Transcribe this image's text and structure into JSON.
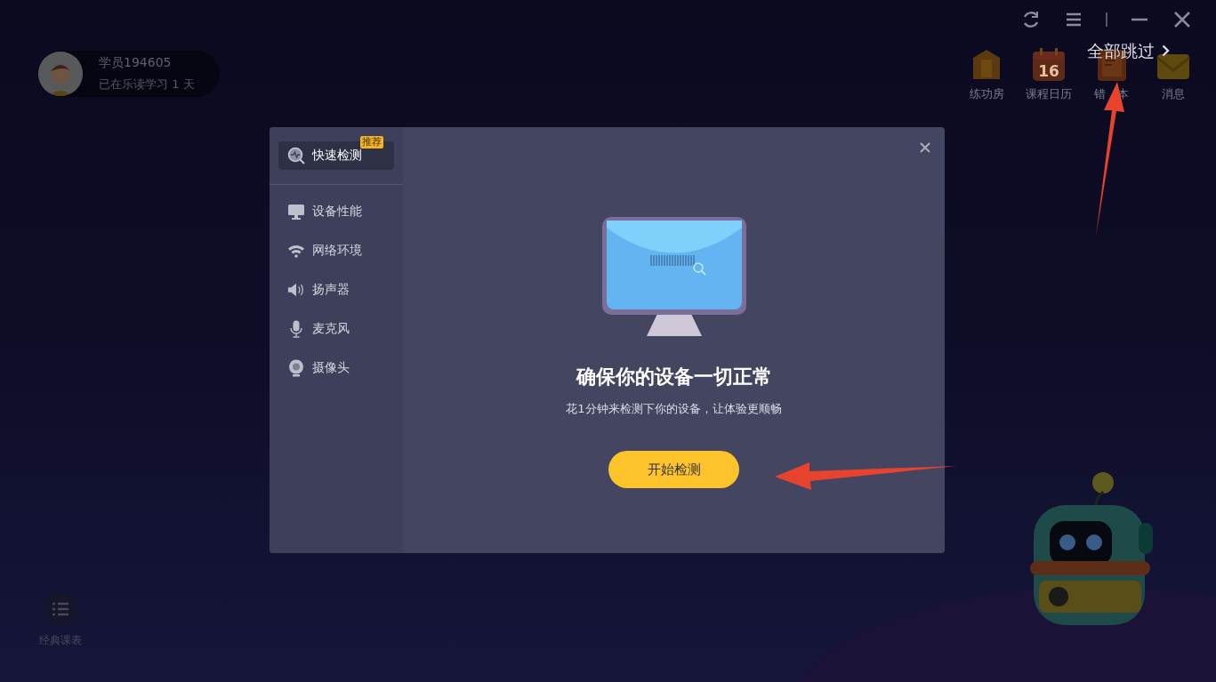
{
  "user": {
    "name": "学员194605",
    "days": "已在乐读学习 1 天"
  },
  "nav": [
    {
      "kind": "practice",
      "label": "练功房"
    },
    {
      "kind": "calendar",
      "label": "课程日历",
      "icon_text": "16"
    },
    {
      "kind": "notebook",
      "label": "错　本"
    },
    {
      "kind": "message",
      "label": "消息"
    }
  ],
  "skip_all": {
    "label": "全部跳过"
  },
  "dialog": {
    "sidebar": [
      {
        "kind": "quick",
        "label": "快速检测",
        "selected": true,
        "badge": "推荐"
      },
      {
        "kind": "monitor",
        "label": "设备性能",
        "selected": false
      },
      {
        "kind": "wifi",
        "label": "网络环境",
        "selected": false
      },
      {
        "kind": "speaker",
        "label": "扬声器",
        "selected": false
      },
      {
        "kind": "mic",
        "label": "麦克风",
        "selected": false
      },
      {
        "kind": "camera",
        "label": "摄像头",
        "selected": false
      }
    ],
    "title": "确保你的设备一切正常",
    "subtitle": "花1分钟来检测下你的设备，让体验更顺畅",
    "start_button": "开始检测"
  },
  "schedule": {
    "label": "经典课表"
  }
}
